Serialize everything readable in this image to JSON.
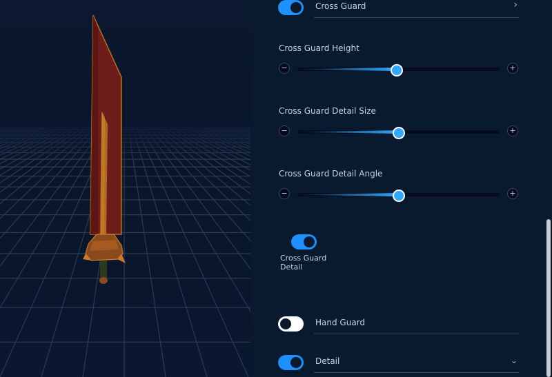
{
  "sections": {
    "cross_guard": {
      "label": "Cross Guard",
      "enabled": true,
      "chevron": "chevron-right-icon"
    },
    "hand_guard": {
      "label": "Hand Guard",
      "enabled": false
    },
    "detail": {
      "label": "Detail",
      "enabled": true,
      "chevron": "chevron-down-icon"
    }
  },
  "sliders": [
    {
      "label": "Cross Guard Height",
      "value": 0.49,
      "minus": "−",
      "plus": "+"
    },
    {
      "label": "Cross Guard Detail Size",
      "value": 0.5,
      "minus": "−",
      "plus": "+"
    },
    {
      "label": "Cross Guard Detail Angle",
      "value": 0.5,
      "minus": "−",
      "plus": "+"
    }
  ],
  "cross_guard_detail": {
    "label": "Cross Guard Detail",
    "enabled": true
  },
  "colors": {
    "accent": "#1e90ff",
    "panel": "#0a1a2e",
    "blade": "#7a1f1a",
    "grid": "#2b3850"
  },
  "viewport": {
    "object": "sword-model"
  }
}
